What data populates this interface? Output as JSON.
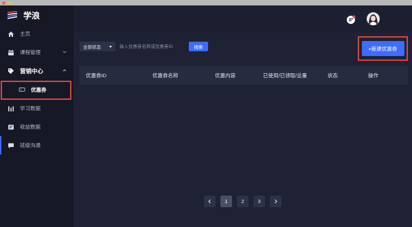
{
  "brand": {
    "name": "学浪"
  },
  "sidebar": {
    "items": [
      {
        "label": "主页",
        "icon": "home-icon"
      },
      {
        "label": "课程管理",
        "icon": "calendar-icon",
        "chevron": "chevron-down-icon"
      },
      {
        "label": "营销中心",
        "icon": "tag-icon",
        "chevron": "chevron-up-icon"
      },
      {
        "label": "优惠券",
        "icon": "coupon-icon"
      },
      {
        "label": "学习数据",
        "icon": "bar-chart-icon"
      },
      {
        "label": "收益数据",
        "icon": "wallet-icon"
      },
      {
        "label": "班级沟通",
        "icon": "chat-icon"
      }
    ]
  },
  "header": {
    "message_icon": "message-icon",
    "avatar": "user-avatar"
  },
  "filters": {
    "status_value": "全部状态",
    "search_placeholder": "输入优惠券名称或优惠券ID",
    "search_label": "搜索"
  },
  "new_coupon_label": "+新建优惠券",
  "table": {
    "columns": [
      "优惠券ID",
      "优惠券名称",
      "优惠内容",
      "已使用/已领取/总量",
      "状态",
      "操作"
    ]
  },
  "pagination": {
    "pages": [
      "1",
      "2",
      "3"
    ],
    "current": "1"
  },
  "colors": {
    "accent": "#3d6cff",
    "highlight": "#d9473a",
    "sidebar_bg": "#161826",
    "main_bg": "#1f2235"
  }
}
